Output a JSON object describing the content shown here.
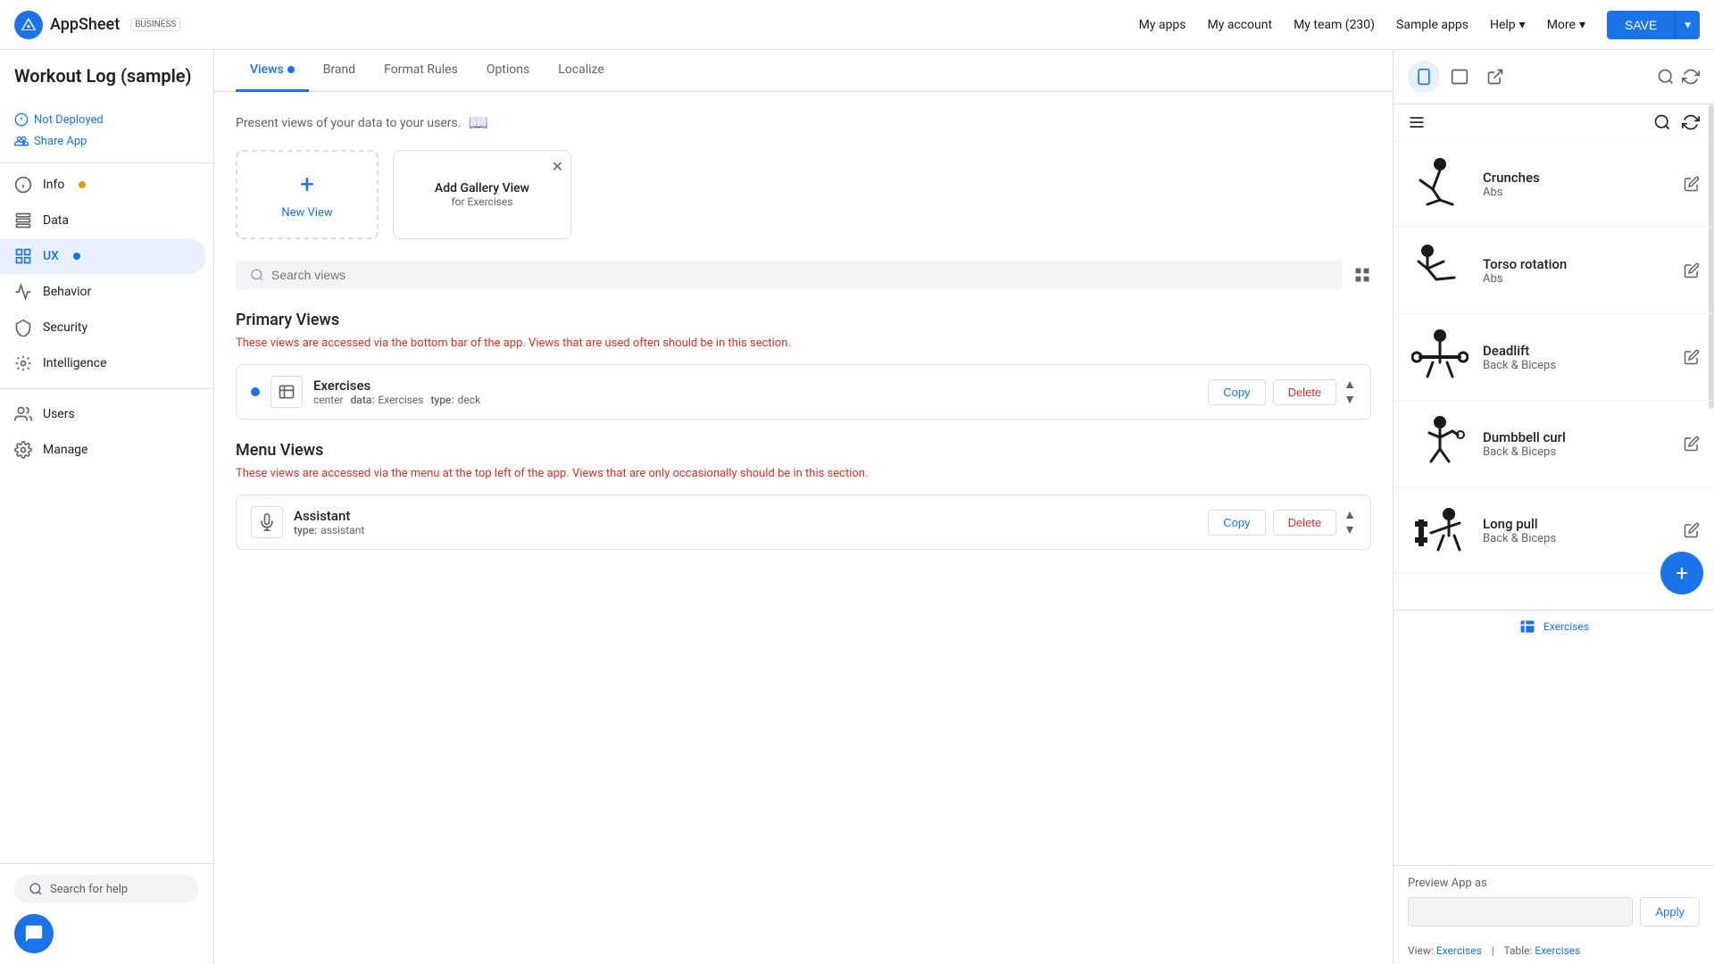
{
  "app": {
    "title": "Workout Log (sample)",
    "status": "Not Deployed",
    "share": "Share App"
  },
  "topnav": {
    "logo_text": "AppSheet",
    "logo_badge": "BUSINESS",
    "links": [
      "My apps",
      "My account",
      "My team (230)",
      "Sample apps",
      "Help",
      "More"
    ],
    "save_label": "SAVE"
  },
  "sidebar": {
    "items": [
      {
        "id": "info",
        "label": "Info",
        "has_dot": true,
        "dot_color": "orange"
      },
      {
        "id": "data",
        "label": "Data",
        "has_dot": false
      },
      {
        "id": "ux",
        "label": "UX",
        "has_dot": true,
        "dot_color": "blue",
        "active": true
      },
      {
        "id": "behavior",
        "label": "Behavior",
        "has_dot": false
      },
      {
        "id": "security",
        "label": "Security",
        "has_dot": false
      },
      {
        "id": "intelligence",
        "label": "Intelligence",
        "has_dot": false
      },
      {
        "id": "users",
        "label": "Users",
        "has_dot": false
      },
      {
        "id": "manage",
        "label": "Manage",
        "has_dot": false
      }
    ],
    "search_placeholder": "Search for help"
  },
  "tabs": [
    {
      "id": "views",
      "label": "Views",
      "active": true,
      "has_dot": true
    },
    {
      "id": "brand",
      "label": "Brand",
      "active": false
    },
    {
      "id": "format-rules",
      "label": "Format Rules",
      "active": false
    },
    {
      "id": "options",
      "label": "Options",
      "active": false
    },
    {
      "id": "localize",
      "label": "Localize",
      "active": false
    }
  ],
  "content": {
    "description": "Present views of your data to your users.",
    "add_new_label": "New View",
    "suggest_title": "Add Gallery View",
    "suggest_sub": "for Exercises",
    "search_placeholder": "Search views",
    "primary_views": {
      "title": "Primary Views",
      "description": "These views are accessed via the bottom bar of the app. Views that are used often should be in this section.",
      "items": [
        {
          "name": "Exercises",
          "center_label": "center",
          "data_label": "data:",
          "data_value": "Exercises",
          "type_label": "type:",
          "type_value": "deck",
          "copy_label": "Copy",
          "delete_label": "Delete",
          "has_dot": true
        }
      ]
    },
    "menu_views": {
      "title": "Menu Views",
      "description": "These views are accessed via the menu at the top left of the app. Views that are only occasionally should be in this section.",
      "items": [
        {
          "name": "Assistant",
          "type_label": "type:",
          "type_value": "assistant",
          "copy_label": "Copy",
          "delete_label": "Delete",
          "has_dot": false
        }
      ]
    }
  },
  "preview": {
    "exercises": [
      {
        "name": "Crunches",
        "category": "Abs",
        "icon_type": "crunches"
      },
      {
        "name": "Torso rotation",
        "category": "Abs",
        "icon_type": "torso"
      },
      {
        "name": "Deadlift",
        "category": "Back & Biceps",
        "icon_type": "deadlift"
      },
      {
        "name": "Dumbbell curl",
        "category": "Back & Biceps",
        "icon_type": "dumbbell"
      },
      {
        "name": "Long pull",
        "category": "Back & Biceps",
        "icon_type": "longpull"
      }
    ],
    "bottom_nav_label": "Exercises",
    "preview_app_as_label": "Preview App as",
    "apply_label": "Apply",
    "view_label": "View:",
    "view_value": "Exercises",
    "table_label": "Table:",
    "table_value": "Exercises"
  }
}
